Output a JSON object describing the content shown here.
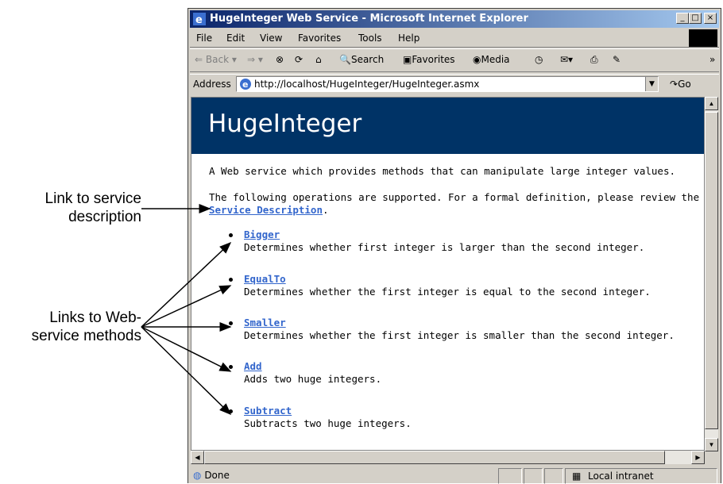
{
  "annotations": {
    "service_description_label": [
      "Link to service",
      "description"
    ],
    "methods_label": [
      "Links to Web-",
      "service methods"
    ]
  },
  "window": {
    "title": "HugeInteger Web Service - Microsoft Internet Explorer",
    "minimize": "_",
    "maximize": "□",
    "close": "×"
  },
  "menu": [
    "File",
    "Edit",
    "View",
    "Favorites",
    "Tools",
    "Help"
  ],
  "toolbar": {
    "back": "Back",
    "search": "Search",
    "favorites": "Favorites",
    "media": "Media",
    "more": "»"
  },
  "address": {
    "label": "Address",
    "url": "http://localhost/HugeInteger/HugeInteger.asmx",
    "go": "Go"
  },
  "page": {
    "heading": "HugeInteger",
    "intro": "A Web service which provides methods that can manipulate large integer values.",
    "ops_text": "The following operations are supported. For a formal definition, please review the",
    "service_link": "Service Description",
    "period": ".",
    "methods": [
      {
        "name": "Bigger",
        "desc": "Determines whether first integer is larger than the second integer."
      },
      {
        "name": "EqualTo",
        "desc": "Determines whether the first integer is equal to the second integer."
      },
      {
        "name": "Smaller",
        "desc": "Determines whether the first integer is smaller than the second integer."
      },
      {
        "name": "Add",
        "desc": "Adds two huge integers."
      },
      {
        "name": "Subtract",
        "desc": "Subtracts two huge integers."
      }
    ]
  },
  "status": {
    "text": "Done",
    "zone": "Local intranet"
  }
}
